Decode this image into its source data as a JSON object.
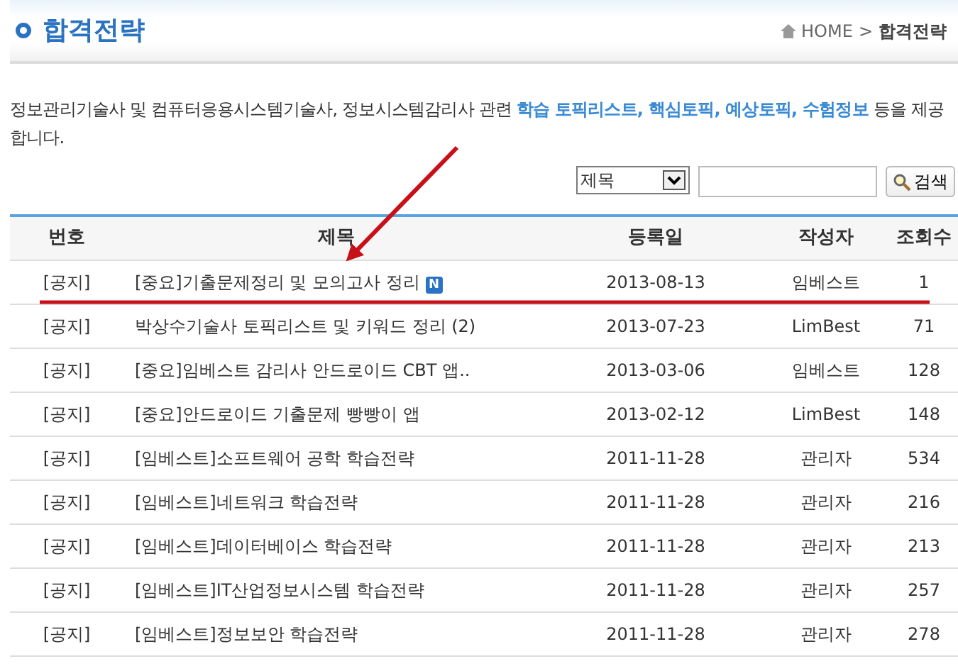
{
  "page_title": "합격전략",
  "breadcrumb": {
    "home": "HOME",
    "separator": ">",
    "current": "합격전략"
  },
  "description": {
    "before": "정보관리기술사 및 컴퓨터응용시스템기술사, 정보시스템감리사 관련 ",
    "highlight": "학습 토픽리스트, 핵심토픽, 예상토픽, 수험정보",
    "after": " 등을 제공합니다."
  },
  "search": {
    "field_select": "제목",
    "button": "검색"
  },
  "table": {
    "columns": [
      "번호",
      "제목",
      "등록일",
      "작성자",
      "조회수"
    ],
    "rows": [
      {
        "number": "[공지]",
        "title": "[중요]기출문제정리 및 모의고사 정리",
        "badge": "N",
        "date": "2013-08-13",
        "author": "임베스트",
        "views": "1"
      },
      {
        "number": "[공지]",
        "title": "박상수기술사 토픽리스트 및 키워드 정리 (2)",
        "date": "2013-07-23",
        "author": "LimBest",
        "views": "71"
      },
      {
        "number": "[공지]",
        "title": "[중요]임베스트 감리사 안드로이드 CBT 앱..",
        "date": "2013-03-06",
        "author": "임베스트",
        "views": "128"
      },
      {
        "number": "[공지]",
        "title": "[중요]안드로이드 기출문제 빵빵이 앱",
        "date": "2013-02-12",
        "author": "LimBest",
        "views": "148"
      },
      {
        "number": "[공지]",
        "title": "[임베스트]소프트웨어 공학 학습전략",
        "date": "2011-11-28",
        "author": "관리자",
        "views": "534"
      },
      {
        "number": "[공지]",
        "title": "[임베스트]네트워크 학습전략",
        "date": "2011-11-28",
        "author": "관리자",
        "views": "216"
      },
      {
        "number": "[공지]",
        "title": "[임베스트]데이터베이스 학습전략",
        "date": "2011-11-28",
        "author": "관리자",
        "views": "213"
      },
      {
        "number": "[공지]",
        "title": "[임베스트]IT산업정보시스템 학습전략",
        "date": "2011-11-28",
        "author": "관리자",
        "views": "257"
      },
      {
        "number": "[공지]",
        "title": "[임베스트]정보보안 학습전략",
        "date": "2011-11-28",
        "author": "관리자",
        "views": "278"
      }
    ]
  }
}
